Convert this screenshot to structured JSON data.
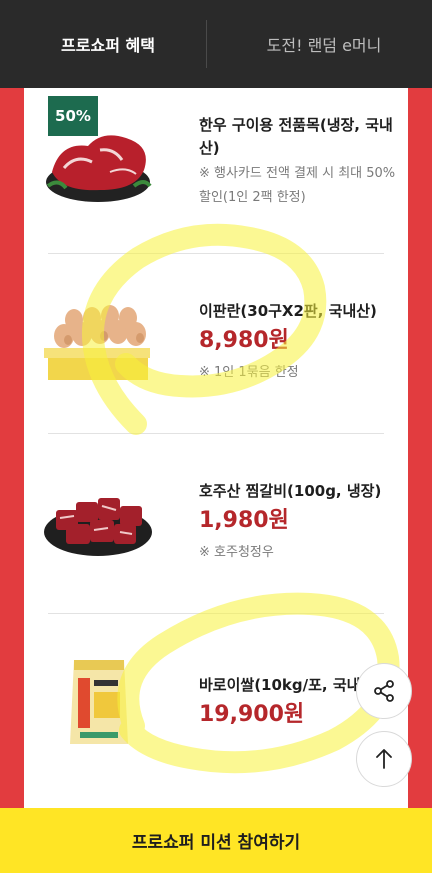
{
  "tabs": [
    {
      "label": "프로쇼퍼 혜택",
      "active": true
    },
    {
      "label": "도전! 랜덤 e머니",
      "active": false
    }
  ],
  "products": [
    {
      "name": "한우 구이용 전품목(냉장, 국내산)",
      "note": "※ 행사카드 전액 결제 시 최대 50%할인(1인 2팩 한정)",
      "badge": "50%",
      "image": "beef-image"
    },
    {
      "name": "이판란(30구X2판, 국내산)",
      "price": "8,980원",
      "note": "※ 1인 1묶음 한정",
      "image": "eggs-image"
    },
    {
      "name": "호주산 찜갈비(100g, 냉장)",
      "price": "1,980원",
      "note": "※ 호주청정우",
      "image": "beef-ribs-image"
    },
    {
      "name": "바로이쌀(10kg/포, 국내산)",
      "price": "19,900원",
      "image": "rice-bag-image"
    }
  ],
  "buttons": {
    "share_icon": "share-icon",
    "top_icon": "arrow-up-icon"
  },
  "cta": {
    "label": "프로쇼퍼 미션 참여하기"
  },
  "colors": {
    "accent_red": "#b5272b",
    "background_red": "#e23c3f",
    "cta_yellow": "#ffe525",
    "badge_green": "#1d6b4f"
  }
}
